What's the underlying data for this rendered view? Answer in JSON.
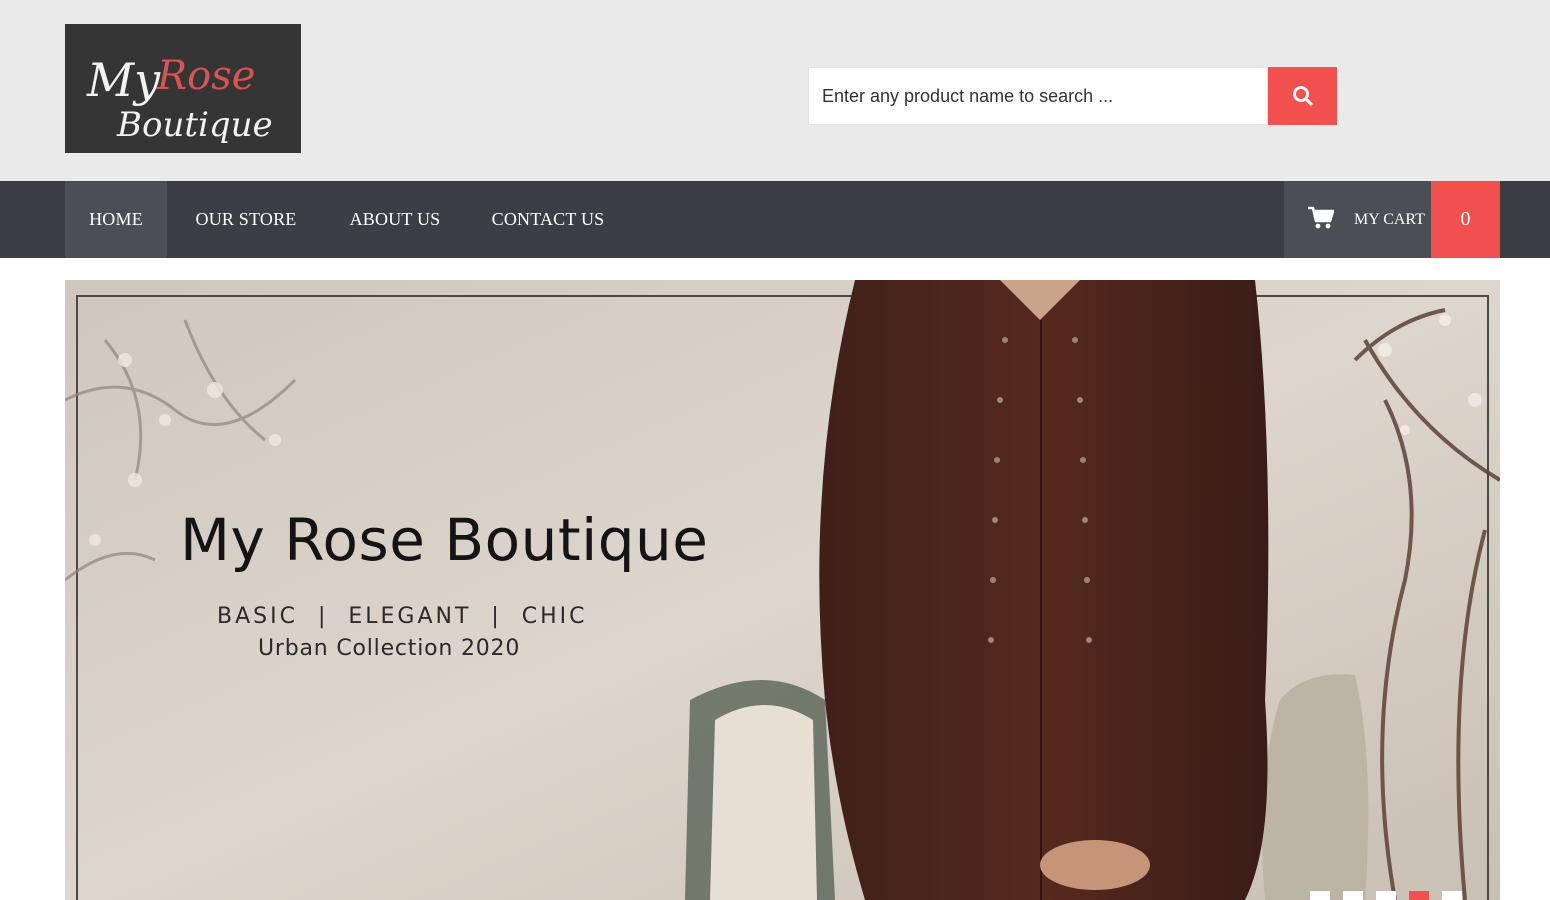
{
  "header": {
    "logo": {
      "line1": "My",
      "line2": "Rose",
      "line3": "Boutique"
    },
    "search": {
      "placeholder": "Enter any product name to search ...",
      "value": "",
      "icon": "search-icon"
    }
  },
  "nav": {
    "items": [
      {
        "label": "HOME",
        "active": true
      },
      {
        "label": "OUR STORE",
        "active": false
      },
      {
        "label": "ABOUT US",
        "active": false
      },
      {
        "label": "CONTACT US",
        "active": false
      }
    ],
    "cart": {
      "icon": "shopping-cart-icon",
      "label": "MY CART",
      "count": "0"
    }
  },
  "hero": {
    "title": "My Rose Boutique",
    "tagline": "BASIC  |  ELEGANT  |  CHIC",
    "collection": "Urban Collection 2020",
    "slides_total": 5,
    "active_slide": 4
  },
  "colors": {
    "accent": "#f24f4f",
    "nav_bg": "#3b3e44",
    "nav_active_bg": "#4a4e55",
    "header_bg": "#eaeaea"
  }
}
